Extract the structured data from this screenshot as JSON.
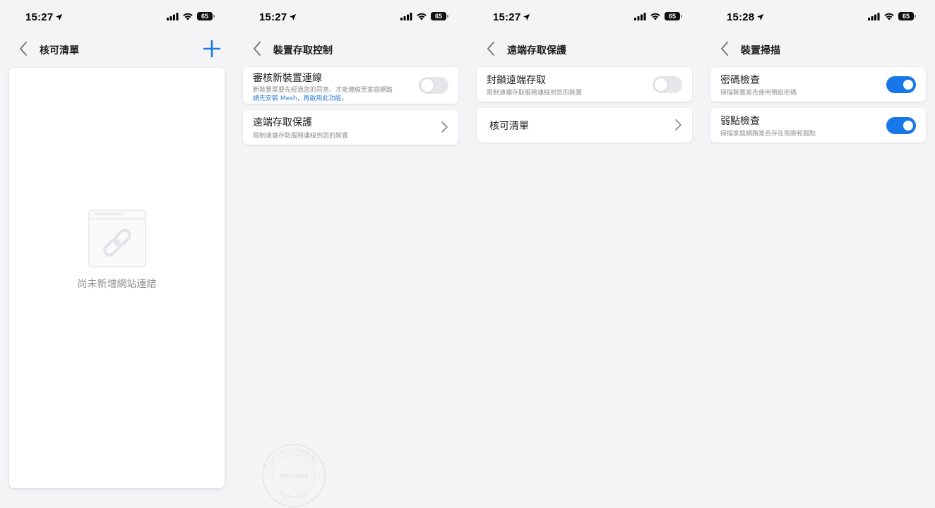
{
  "screens": [
    {
      "time": "15:27",
      "battery": "65",
      "title": "核可清單",
      "empty_text": "尚未新增網站連結"
    },
    {
      "time": "15:27",
      "battery": "65",
      "title": "裝置存取控制",
      "rows": [
        {
          "title": "審核新裝置連線",
          "subtitle": "新裝置需要先經過您的同意，才能連線至家庭網路",
          "link": "請先安裝 Mesh，再啟用此功能。",
          "toggle": "off"
        },
        {
          "title": "遠端存取保護",
          "subtitle": "限制遠端存取服務連線到您的裝置"
        }
      ]
    },
    {
      "time": "15:27",
      "battery": "65",
      "title": "遠端存取保護",
      "rows": [
        {
          "title": "封鎖遠端存取",
          "subtitle": "限制遠端存取服務連線到您的裝置",
          "toggle": "off"
        },
        {
          "title": "核可清單"
        }
      ]
    },
    {
      "time": "15:28",
      "battery": "65",
      "title": "裝置掃描",
      "rows": [
        {
          "title": "密碼檢查",
          "subtitle": "掃描裝置是否使用預設密碼",
          "toggle": "on"
        },
        {
          "title": "弱點檢查",
          "subtitle": "掃描家庭網路是否存在風險和弱點",
          "toggle": "on"
        }
      ]
    }
  ],
  "watermark": {
    "top": "3C·TECH·GAMING",
    "center": "TECHSPACE",
    "bottom": "EST 2022"
  },
  "colors": {
    "accent": "#1877e8",
    "link": "#2e7bd6",
    "toggle_off": "#e6e6ea",
    "background": "#f4f4f6",
    "secondary_text": "#8e8e93"
  },
  "icons": [
    "location-arrow-icon",
    "cellular-signal-icon",
    "wifi-icon",
    "battery-icon",
    "back-chevron-icon",
    "plus-icon",
    "chevron-right-icon",
    "link-illustration-icon"
  ]
}
